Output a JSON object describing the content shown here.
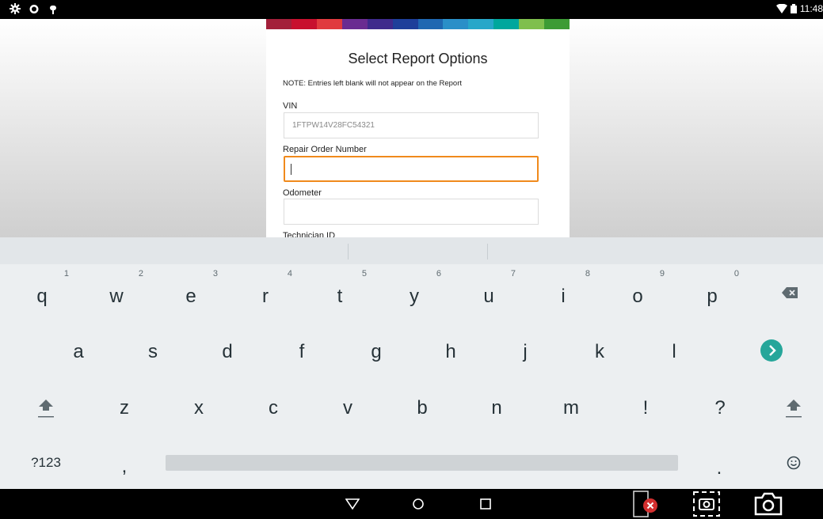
{
  "statusbar": {
    "time": "11:48"
  },
  "form": {
    "title": "Select Report Options",
    "note": "NOTE: Entries left blank will not appear on the Report",
    "vin_label": "VIN",
    "vin_value": "1FTPW14V28FC54321",
    "ro_label": "Repair Order Number",
    "ro_value": "",
    "odometer_label": "Odometer",
    "odometer_value": "",
    "tech_label": "Technician ID"
  },
  "brand_colors": [
    "#a3203a",
    "#c8102e",
    "#e03a3e",
    "#6a2c91",
    "#3f2a8c",
    "#1e3f9a",
    "#1f67b1",
    "#2a8fc8",
    "#27a7c9",
    "#00a79d",
    "#7fbf4d",
    "#3d9b35"
  ],
  "accent_focus": "#f08a1c",
  "keyboard": {
    "row1": [
      {
        "k": "q",
        "h": "1"
      },
      {
        "k": "w",
        "h": "2"
      },
      {
        "k": "e",
        "h": "3"
      },
      {
        "k": "r",
        "h": "4"
      },
      {
        "k": "t",
        "h": "5"
      },
      {
        "k": "y",
        "h": "6"
      },
      {
        "k": "u",
        "h": "7"
      },
      {
        "k": "i",
        "h": "8"
      },
      {
        "k": "o",
        "h": "9"
      },
      {
        "k": "p",
        "h": "0"
      }
    ],
    "row2": [
      "a",
      "s",
      "d",
      "f",
      "g",
      "h",
      "j",
      "k",
      "l"
    ],
    "row3": [
      "z",
      "x",
      "c",
      "v",
      "b",
      "n",
      "m",
      "!",
      "?"
    ],
    "symbols_label": "?123",
    "comma": ",",
    "period": "."
  }
}
